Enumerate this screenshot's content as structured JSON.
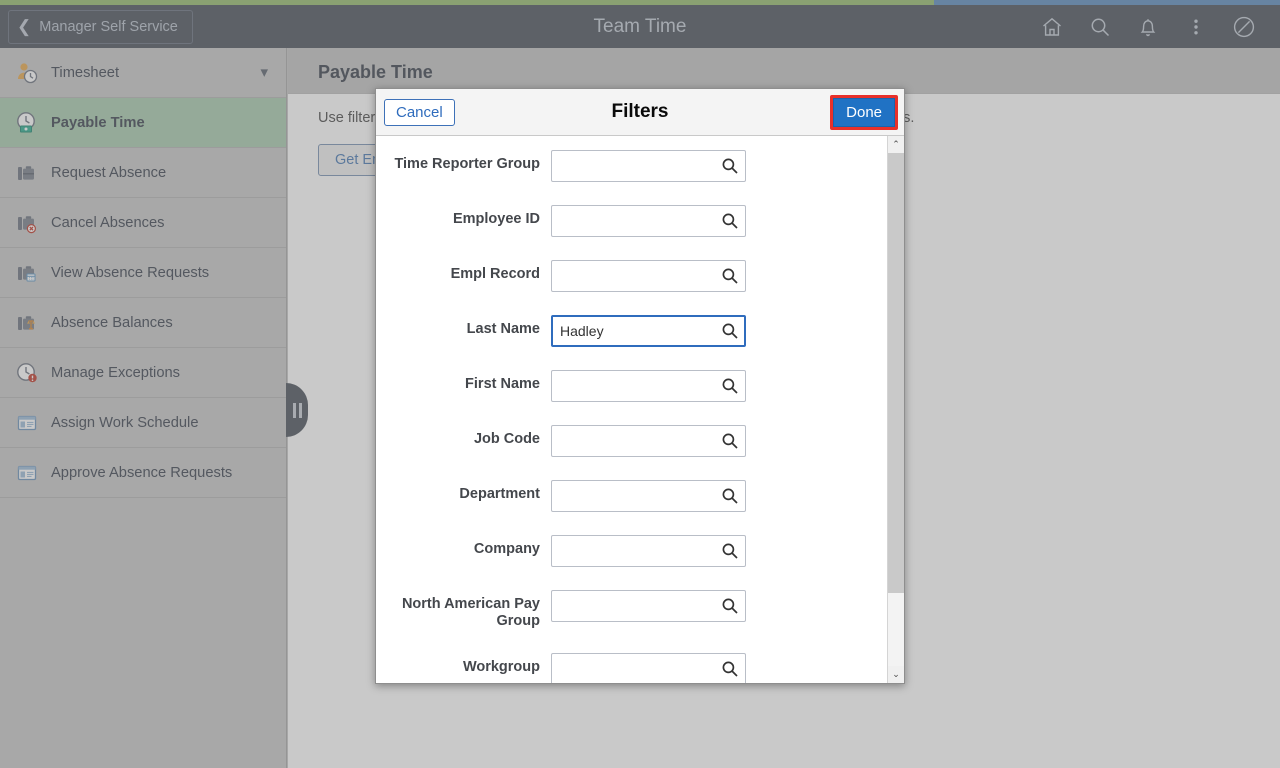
{
  "theme": {
    "header_bg": "#4c535d",
    "progress_green": "#96bc6e",
    "progress_blue": "#5c8cbe",
    "sidebar_bg": "#c8c8c8",
    "active_item_bg": "#a9cbb0",
    "accent_blue": "#2072c4",
    "highlight_red": "#e8302a"
  },
  "progress": {
    "percent": 73
  },
  "header": {
    "back_label": "Manager Self Service",
    "title": "Team Time",
    "icons": [
      {
        "name": "home-icon",
        "label": "Home"
      },
      {
        "name": "search-icon",
        "label": "Search"
      },
      {
        "name": "notifications-bell-icon",
        "label": "Notifications"
      },
      {
        "name": "actions-menu-icon",
        "label": "Actions List"
      },
      {
        "name": "navbar-icon",
        "label": "NavBar"
      }
    ]
  },
  "sidebar": {
    "items": [
      {
        "label": "Timesheet",
        "icon": "person-clock-icon",
        "active": false,
        "expandable": true
      },
      {
        "label": "Payable Time",
        "icon": "clock-money-icon",
        "active": true,
        "expandable": false
      },
      {
        "label": "Request Absence",
        "icon": "briefcase-icon",
        "active": false,
        "expandable": false
      },
      {
        "label": "Cancel Absences",
        "icon": "briefcase-cancel-icon",
        "active": false,
        "expandable": false
      },
      {
        "label": "View Absence Requests",
        "icon": "briefcase-calendar-icon",
        "active": false,
        "expandable": false
      },
      {
        "label": "Absence Balances",
        "icon": "briefcase-balance-icon",
        "active": false,
        "expandable": false
      },
      {
        "label": "Manage Exceptions",
        "icon": "clock-alert-icon",
        "active": false,
        "expandable": false
      },
      {
        "label": "Assign Work Schedule",
        "icon": "window-panel-icon",
        "active": false,
        "expandable": false
      },
      {
        "label": "Approve Absence Requests",
        "icon": "window-panel-icon",
        "active": false,
        "expandable": false
      }
    ],
    "collapse_handle_label": "Collapse menu"
  },
  "content": {
    "page_title": "Payable Time",
    "instruction": "Use filters to change the search criteria or Get Employees to use the current Search Options.",
    "get_employees_label": "Get Employees"
  },
  "modal": {
    "title": "Filters",
    "cancel_label": "Cancel",
    "done_label": "Done",
    "done_highlighted": true,
    "fields": [
      {
        "label": "Time Reporter Group",
        "value": "",
        "placeholder": "",
        "focused": false,
        "lookup": true
      },
      {
        "label": "Employee ID",
        "value": "",
        "placeholder": "",
        "focused": false,
        "lookup": true
      },
      {
        "label": "Empl Record",
        "value": "",
        "placeholder": "",
        "focused": false,
        "lookup": true
      },
      {
        "label": "Last Name",
        "value": "Hadley",
        "placeholder": "",
        "focused": true,
        "lookup": true
      },
      {
        "label": "First Name",
        "value": "",
        "placeholder": "",
        "focused": false,
        "lookup": true
      },
      {
        "label": "Job Code",
        "value": "",
        "placeholder": "",
        "focused": false,
        "lookup": true
      },
      {
        "label": "Department",
        "value": "",
        "placeholder": "",
        "focused": false,
        "lookup": true
      },
      {
        "label": "Company",
        "value": "",
        "placeholder": "",
        "focused": false,
        "lookup": true
      },
      {
        "label": "North American Pay Group",
        "value": "",
        "placeholder": "",
        "focused": false,
        "lookup": true
      },
      {
        "label": "Workgroup",
        "value": "",
        "placeholder": "",
        "focused": false,
        "lookup": true
      }
    ],
    "scrollbar": {
      "up_arrow": "⌃",
      "down_arrow": "⌄"
    }
  }
}
